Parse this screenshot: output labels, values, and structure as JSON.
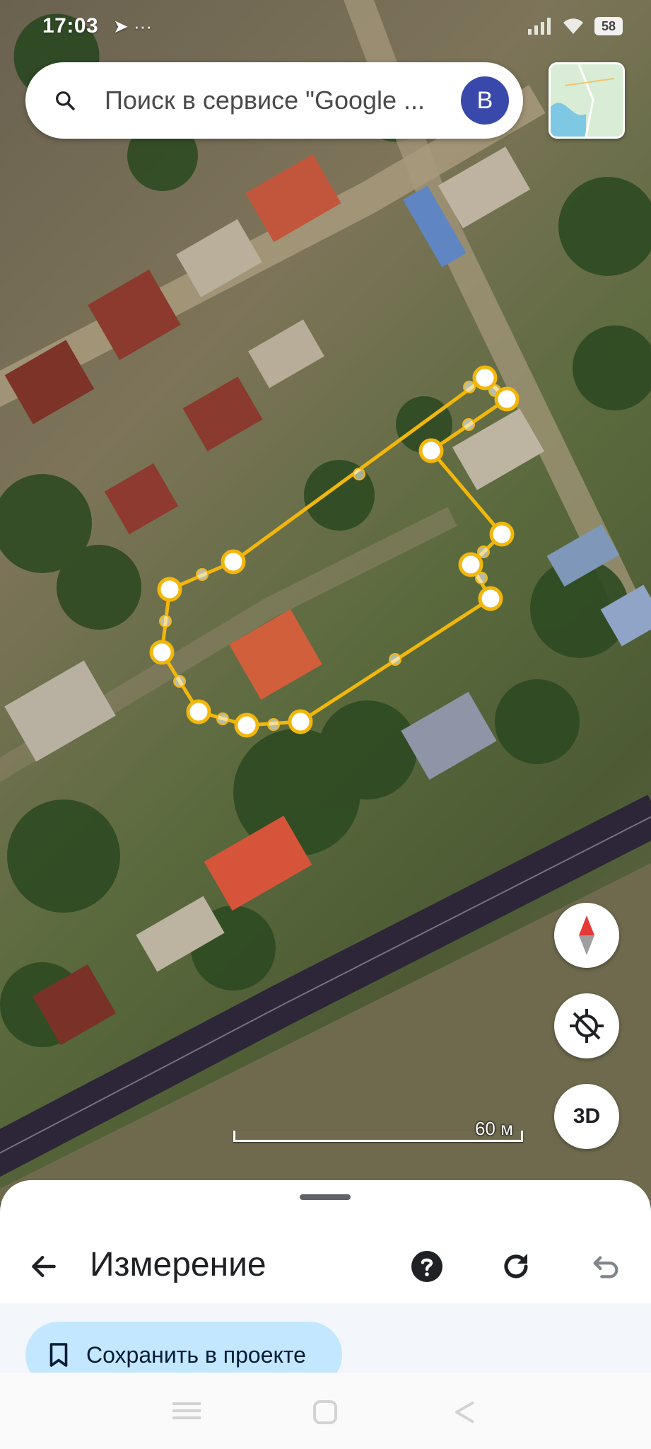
{
  "status_bar": {
    "time": "17:03",
    "extra_icons": "➤ ···",
    "battery": "58"
  },
  "search": {
    "placeholder": "Поиск в сервисе \"Google ...",
    "avatar_letter": "B"
  },
  "map": {
    "scale_label": "60 м",
    "button_3d": "3D"
  },
  "measure_sheet": {
    "title": "Измерение",
    "save_label": "Сохранить в проекте"
  },
  "colors": {
    "measure_line": "#f2b70a",
    "accent": "#3949ab",
    "save_button_bg": "#c2e7ff"
  },
  "icons": [
    "search-icon",
    "compass-icon",
    "location-off-icon",
    "back-arrow-icon",
    "help-icon",
    "refresh-icon",
    "undo-icon",
    "bookmark-icon"
  ]
}
